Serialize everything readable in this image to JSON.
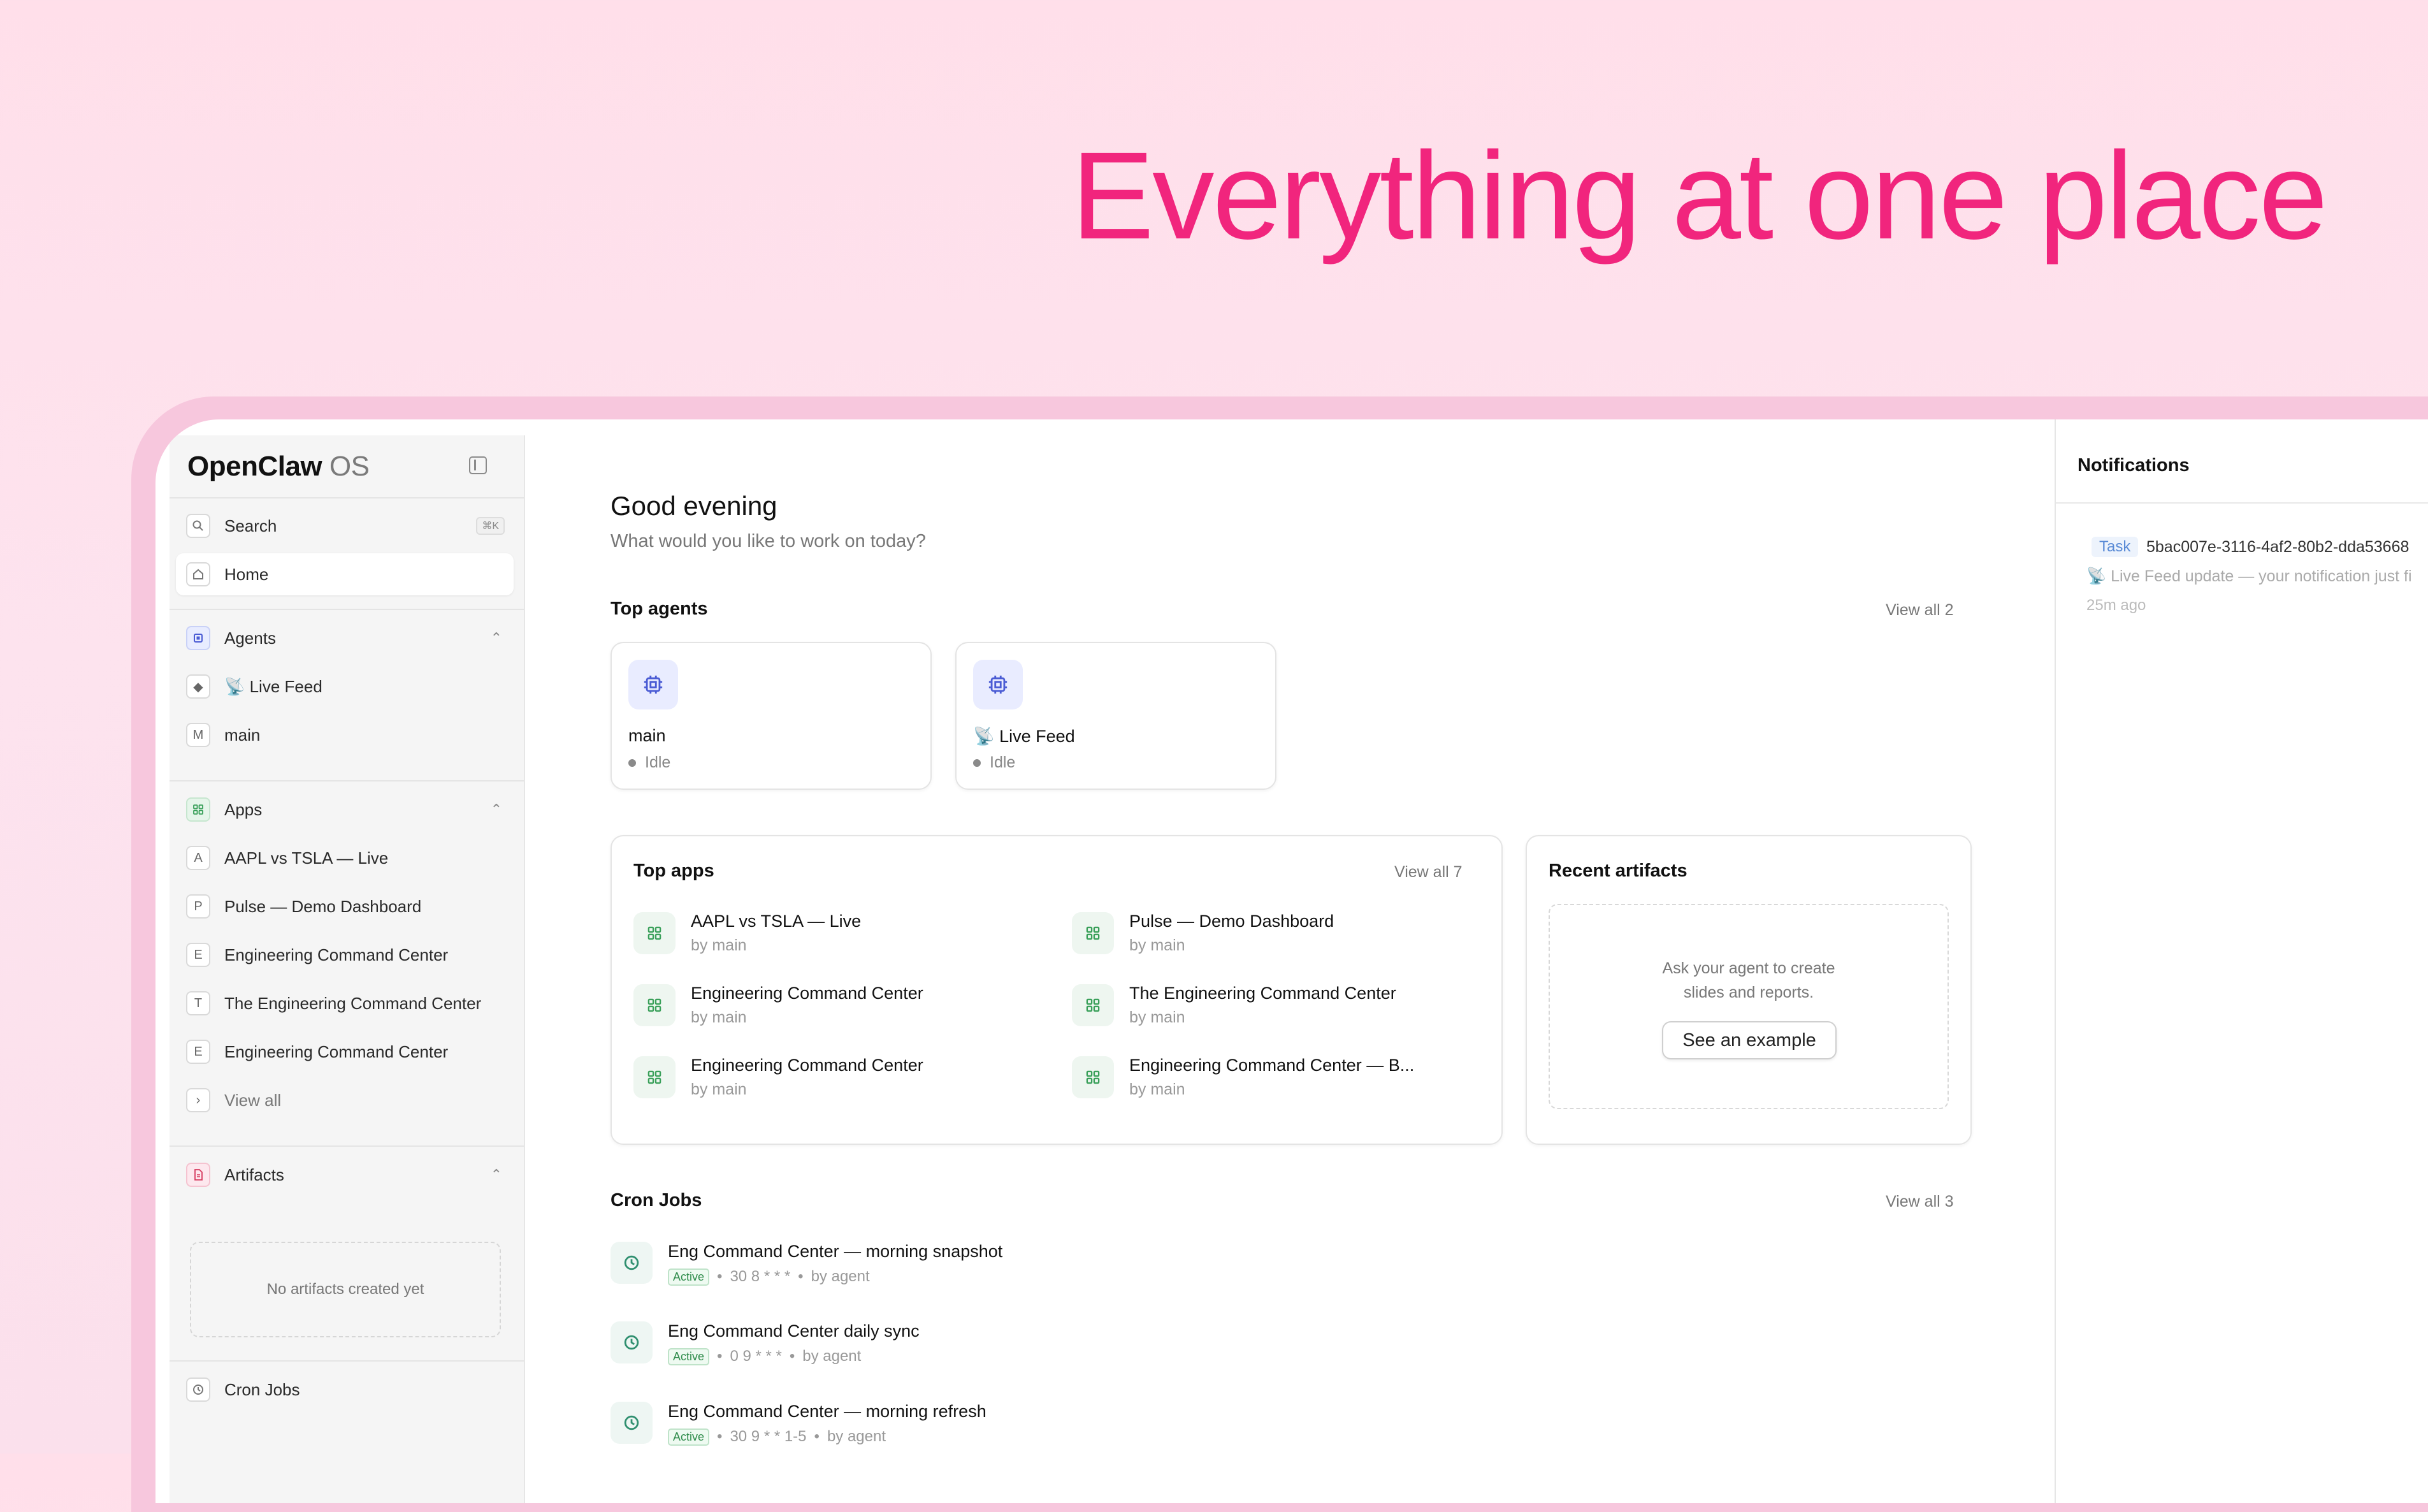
{
  "hero": {
    "headline": "Everything at one place"
  },
  "sidebar": {
    "brand": "OpenClaw",
    "brand_suffix": "OS",
    "search_label": "Search",
    "search_shortcut": "⌘K",
    "home_label": "Home",
    "agents_header": "Agents",
    "agents": [
      {
        "label": "📡 Live Feed",
        "icon": "◆"
      },
      {
        "label": "main",
        "icon": "M"
      }
    ],
    "apps_header": "Apps",
    "apps": [
      {
        "label": "AAPL vs TSLA — Live",
        "icon": "A"
      },
      {
        "label": "Pulse — Demo Dashboard",
        "icon": "P"
      },
      {
        "label": "Engineering Command Center",
        "icon": "E"
      },
      {
        "label": "The Engineering Command Center",
        "icon": "T"
      },
      {
        "label": "Engineering Command Center",
        "icon": "E"
      }
    ],
    "view_all": "View all",
    "artifacts_header": "Artifacts",
    "artifacts_empty": "No artifacts created yet",
    "cron_label": "Cron Jobs"
  },
  "main": {
    "greeting": "Good evening",
    "subtitle": "What would you like to work on today?",
    "top_agents_title": "Top agents",
    "top_agents_view_all": "View all 2",
    "agents": [
      {
        "name": "main",
        "status": "Idle"
      },
      {
        "name": "📡 Live Feed",
        "status": "Idle"
      }
    ],
    "top_apps_title": "Top apps",
    "top_apps_view_all": "View all 7",
    "apps": [
      {
        "title": "AAPL vs TSLA — Live",
        "by": "by main"
      },
      {
        "title": "Pulse — Demo Dashboard",
        "by": "by main"
      },
      {
        "title": "Engineering Command Center",
        "by": "by main"
      },
      {
        "title": "The Engineering Command Center",
        "by": "by main"
      },
      {
        "title": "Engineering Command Center",
        "by": "by main"
      },
      {
        "title": "Engineering Command Center — B...",
        "by": "by main"
      }
    ],
    "recent_artifacts_title": "Recent artifacts",
    "artifacts_msg_1": "Ask your agent to create",
    "artifacts_msg_2": "slides and reports.",
    "see_example": "See an example",
    "cron_title": "Cron Jobs",
    "cron_view_all": "View all 3",
    "cron_jobs": [
      {
        "title": "Eng Command Center — morning snapshot",
        "status": "Active",
        "schedule": "30 8 * * *",
        "by": "by agent"
      },
      {
        "title": "Eng Command Center daily sync",
        "status": "Active",
        "schedule": "0 9 * * *",
        "by": "by agent"
      },
      {
        "title": "Eng Command Center — morning refresh",
        "status": "Active",
        "schedule": "30 9 * * 1-5",
        "by": "by agent"
      }
    ]
  },
  "notifications": {
    "title": "Notifications",
    "items": [
      {
        "tag": "Task",
        "id": "5bac007e-3116-4af2-80b2-dda53668",
        "desc": "📡 Live Feed update — your notification just fi",
        "time": "25m ago"
      }
    ]
  },
  "colors": {
    "accent": "#f1257d",
    "agent_icon": "#4a5bd4",
    "app_icon": "#3aa05a",
    "cron_icon": "#2f8f6f"
  }
}
